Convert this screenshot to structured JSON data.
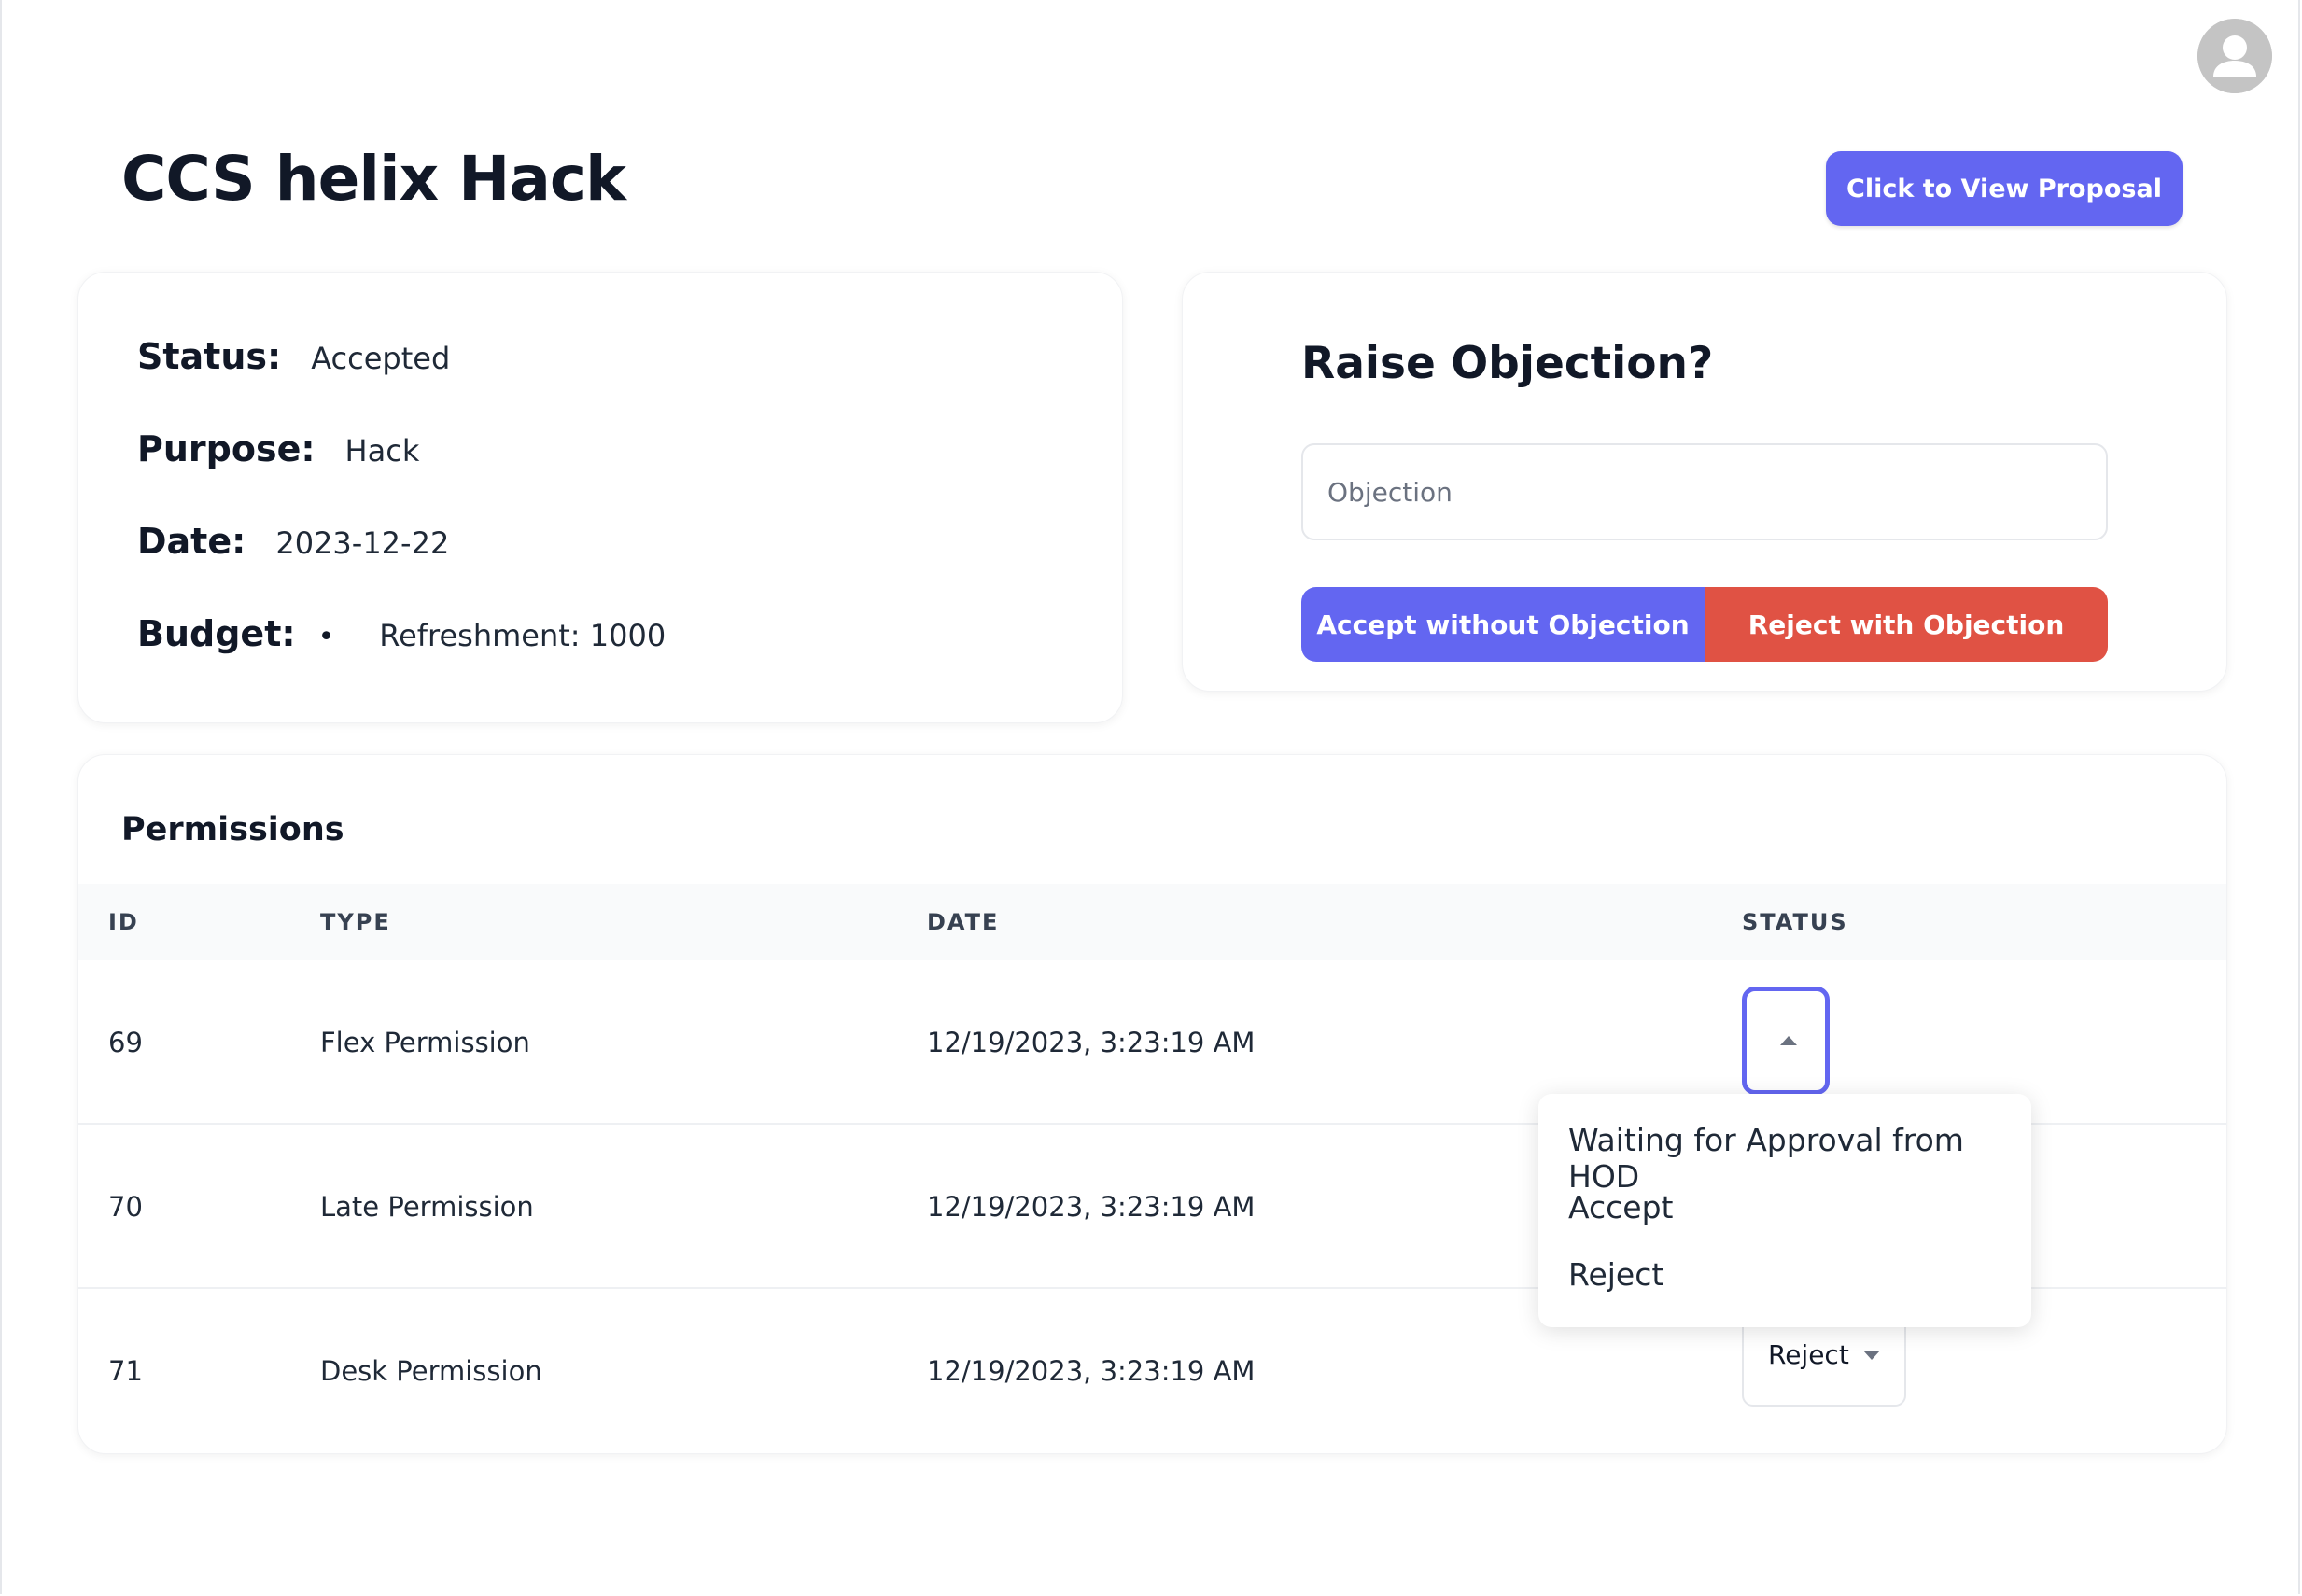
{
  "header": {
    "title": "CCS helix Hack",
    "view_proposal_label": "Click to View Proposal"
  },
  "info": {
    "status_label": "Status:",
    "status_value": "Accepted",
    "purpose_label": "Purpose:",
    "purpose_value": "Hack",
    "date_label": "Date:",
    "date_value": "2023-12-22",
    "budget_label": "Budget:",
    "budget_bullet": "•",
    "budget_items": [
      "Refreshment: 1000"
    ]
  },
  "objection": {
    "title": "Raise Objection?",
    "placeholder": "Objection",
    "accept_label": "Accept without Objection",
    "reject_label": "Reject with Objection"
  },
  "permissions": {
    "title": "Permissions",
    "columns": [
      "ID",
      "TYPE",
      "DATE",
      "STATUS"
    ],
    "rows": [
      {
        "id": "69",
        "type": "Flex Permission",
        "date": "12/19/2023, 3:23:19 AM",
        "status": ""
      },
      {
        "id": "70",
        "type": "Late Permission",
        "date": "12/19/2023, 3:23:19 AM",
        "status": ""
      },
      {
        "id": "71",
        "type": "Desk Permission",
        "date": "12/19/2023, 3:23:19 AM",
        "status": "Reject"
      }
    ]
  },
  "status_dropdown": {
    "options": [
      "Waiting for Approval from HOD",
      "Accept",
      "Reject"
    ]
  },
  "colors": {
    "accent": "#6366f1",
    "danger": "#e05244"
  },
  "icons": {
    "avatar": "user-avatar-icon",
    "open_caret": "caret-up-icon",
    "closed_caret": "caret-down-icon"
  }
}
